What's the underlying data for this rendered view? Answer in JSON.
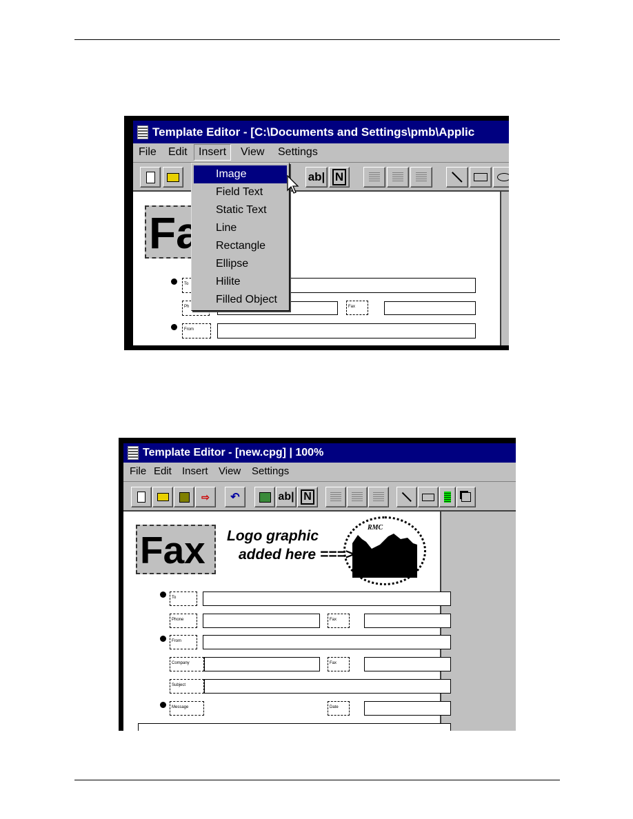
{
  "shot1": {
    "title": "Template Editor - [C:\\Documents and Settings\\pmb\\Applic",
    "menu": [
      "File",
      "Edit",
      "Insert",
      "View",
      "Settings"
    ],
    "open_menu": "Insert",
    "dropdown": [
      "Image",
      "Field Text",
      "Static Text",
      "Line",
      "Rectangle",
      "Ellipse",
      "Hilite",
      "Filled Object"
    ],
    "selected_item": "Image",
    "fax_heading": "Fax",
    "labels": {
      "to": "To",
      "phone": "Ph",
      "fax": "Fax",
      "from": "From"
    },
    "toolbar": {
      "text_tool": "ab|",
      "field_tool": "N"
    }
  },
  "shot2": {
    "title": "Template Editor - [new.cpg] | 100%",
    "menu": [
      "File",
      "Edit",
      "Insert",
      "View",
      "Settings"
    ],
    "toolbar": {
      "text_tool": "ab|",
      "field_tool": "N"
    },
    "fax_heading": "Fax",
    "logo_note_line1": "Logo graphic",
    "logo_note_line2": "added here ===>",
    "logo_text": "RMC",
    "labels": {
      "to": "To",
      "phone": "Phone",
      "fax1": "Fax",
      "from": "From",
      "company": "Company",
      "fax2": "Fax",
      "subject": "Subject",
      "message": "Message",
      "date": "Date"
    }
  },
  "colors": {
    "titlebar": "#000080",
    "chrome": "#c0c0c0",
    "highlight": "#000080"
  }
}
